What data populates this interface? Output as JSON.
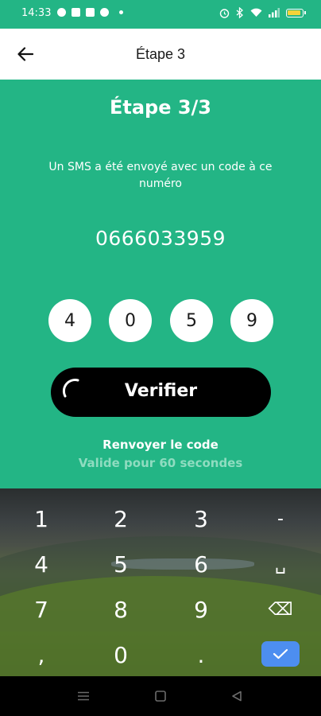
{
  "status_bar": {
    "time": "14:33",
    "battery_color": "#f5d33a",
    "icons": [
      "alarm-icon",
      "bluetooth-icon",
      "wifi-icon",
      "signal-icon",
      "battery-icon"
    ]
  },
  "app_bar": {
    "title": "Étape 3",
    "back_icon": "arrow-left-icon"
  },
  "main": {
    "step_title": "Étape 3/3",
    "sms_message": "Un SMS a été envoyé avec un code à ce numéro",
    "phone_number": "0666033959",
    "code_digits": [
      "4",
      "0",
      "5",
      "9"
    ],
    "verify_label": "Verifier",
    "resend_label": "Renvoyer le code",
    "validity_text": "Valide pour 60 secondes"
  },
  "keyboard": {
    "rows": [
      [
        "1",
        "2",
        "3",
        "-"
      ],
      [
        "4",
        "5",
        "6",
        "␣"
      ],
      [
        "7",
        "8",
        "9",
        "⌫"
      ],
      [
        ",",
        "0",
        ".",
        "✓"
      ]
    ]
  },
  "colors": {
    "primary": "#23b585",
    "button": "#000000",
    "done_key": "#4d8ef0",
    "validity": "#8fdcc0"
  }
}
